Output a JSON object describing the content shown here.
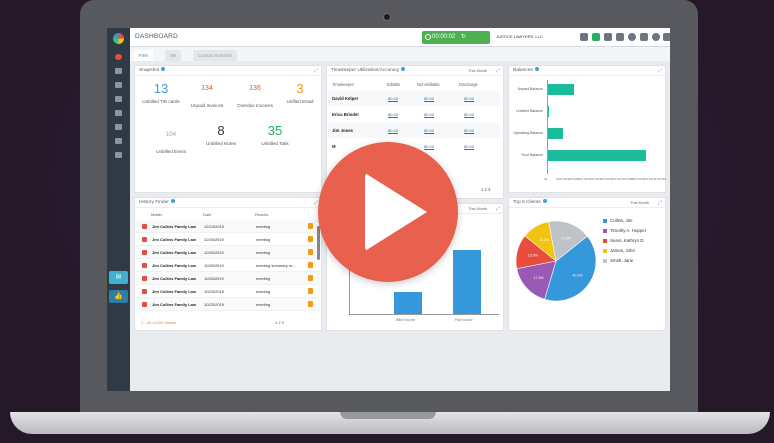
{
  "topbar": {
    "title": "DASHBOARD",
    "timer": "00:00:02",
    "firm": "JUSTICE LAWYERS, LLC"
  },
  "tabs": [
    {
      "label": "Firm"
    },
    {
      "label": "Me"
    },
    {
      "label": "Custom Activities"
    }
  ],
  "snapshot": {
    "title": "Snapshot",
    "items": [
      {
        "value": "13",
        "label": "Unbilled T/E cards",
        "color": "#3fa0d8"
      },
      {
        "value": "134",
        "label": "Unpaid Invoices",
        "color": "#e74c3c"
      },
      {
        "value": "136",
        "label": "Overdue Invoices",
        "color": "#e74c3c"
      },
      {
        "value": "3",
        "label": "Unfiled Email",
        "color": "#f39c12"
      },
      {
        "value": "104",
        "label": "Unbilled Event",
        "color": "#7b8794"
      },
      {
        "value": "8",
        "label": "Unbilled Notes",
        "color": "#333333"
      },
      {
        "value": "35",
        "label": "Unbilled Task",
        "color": "#27ae60"
      }
    ]
  },
  "timekeeper": {
    "title": "Timekeeper Utilization/Accuracy",
    "period": "This Month",
    "columns": [
      "Timekeeper",
      "Billable",
      "Non-Billable",
      "Discharge"
    ],
    "rows": [
      {
        "name": "David Kelper",
        "v1": "$0.00",
        "v2": "$0.00",
        "v3": "$0.00"
      },
      {
        "name": "Erica Brinder",
        "v1": "$0.00",
        "v2": "$0.00",
        "v3": "$0.00"
      },
      {
        "name": "Jim Jones",
        "v1": "$0.00",
        "v2": "$0.00",
        "v3": "$0.00"
      },
      {
        "name": "M",
        "v1": "$0.00",
        "v2": "$0.00",
        "v3": "$0.00"
      }
    ],
    "pager": "1 2 3"
  },
  "balances": {
    "title": "Balances",
    "chart_data": {
      "type": "bar",
      "orientation": "horizontal",
      "categories": [
        "Unpaid Balance",
        "Unbilled Balance",
        "Operating Balance",
        "Trust Balance"
      ],
      "values": [
        250000,
        10000,
        150000,
        920000
      ],
      "xlim": [
        0,
        1000000
      ],
      "ticks": [
        "$0",
        "$100,000",
        "$200,000",
        "$300,000",
        "$400,000",
        "$500,000",
        "$600,000",
        "$700,000",
        "$800,000",
        "$900,000",
        "$1,000,000"
      ]
    }
  },
  "history": {
    "title": "History Finder",
    "columns": [
      "Matter",
      "Date",
      "Results"
    ],
    "rows": [
      {
        "matter": "Jim Collins Family Law",
        "date": "12/23/2019",
        "type": "meeting"
      },
      {
        "matter": "Jim Collins Family Law",
        "date": "11/05/2019",
        "type": "meeting"
      },
      {
        "matter": "Jim Collins Family Law",
        "date": "11/05/2019",
        "type": "meeting"
      },
      {
        "matter": "Jim Collins Family Law",
        "date": "11/05/2019",
        "type": "meeting summary re..."
      },
      {
        "matter": "Jim Collins Family Law",
        "date": "11/05/2019",
        "type": "meeting"
      },
      {
        "matter": "Jim Collins Family Law",
        "date": "10/23/2019",
        "type": "meeting"
      },
      {
        "matter": "Jim Collins Family Law",
        "date": "10/23/2019",
        "type": "meeting"
      }
    ],
    "footer": "1 - 20 of 100 results",
    "pager": "1 2 3"
  },
  "middle_chart": {
    "period": "This Month",
    "chart_data": {
      "type": "bar",
      "categories": [
        "Billed Income",
        "Paid Income"
      ],
      "values": [
        30,
        85
      ],
      "ylim": [
        0,
        120
      ],
      "color": "#3498db"
    }
  },
  "top_clients": {
    "title": "Top 5 Clients",
    "period": "This Month",
    "chart_data": {
      "type": "pie",
      "labels": [
        "Collins, Jim",
        "Timothy A. Hopper",
        "Sears, Kathryn D.",
        "James, John",
        "Smith, Jane"
      ],
      "values": [
        40.3,
        17.3,
        13.9,
        11.2,
        17.3
      ],
      "colors": [
        "#3498db",
        "#9b59b6",
        "#e74c3c",
        "#f1c40f",
        "#bdc3c7"
      ],
      "pct_labels": [
        "40.3%",
        "17.3%",
        "13.9%",
        "11.2%",
        "17.3%"
      ]
    }
  }
}
